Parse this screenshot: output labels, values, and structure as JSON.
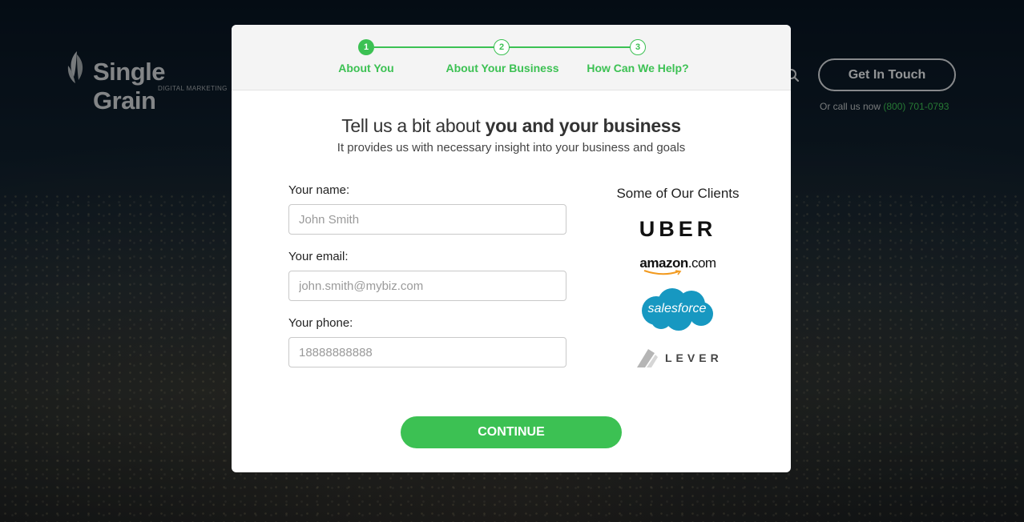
{
  "header": {
    "logo_name": "Single Grain",
    "logo_sub": "DIGITAL MARKETING",
    "cta_label": "Get In Touch",
    "call_text": "Or call us now",
    "call_phone": "(800) 701-0793"
  },
  "modal": {
    "steps": [
      {
        "number": "1",
        "label": "About You",
        "state": "active"
      },
      {
        "number": "2",
        "label": "About Your Business",
        "state": "todo"
      },
      {
        "number": "3",
        "label": "How Can We Help?",
        "state": "todo"
      }
    ],
    "heading_light": "Tell us a bit about ",
    "heading_bold": "you and your business",
    "subheading": "It provides us with necessary insight into your business and goals",
    "fields": {
      "name": {
        "label": "Your name:",
        "placeholder": "John Smith",
        "value": ""
      },
      "email": {
        "label": "Your email:",
        "placeholder": "john.smith@mybiz.com",
        "value": ""
      },
      "phone": {
        "label": "Your phone:",
        "placeholder": "18888888888",
        "value": ""
      }
    },
    "clients": {
      "title": "Some of Our Clients",
      "uber": "UBER",
      "amazon_main": "amazon",
      "amazon_com": ".com",
      "salesforce": "salesforce",
      "lever": "LEVER"
    },
    "continue_label": "CONTINUE"
  },
  "colors": {
    "accent": "#3cc153",
    "modal_bg": "#ffffff",
    "steps_bg": "#f4f4f4",
    "salesforce_blue": "#1798c1"
  },
  "icons": [
    "leaf-logo-icon",
    "search-icon",
    "amazon-smile-icon",
    "salesforce-cloud-icon",
    "lever-mark-icon"
  ]
}
